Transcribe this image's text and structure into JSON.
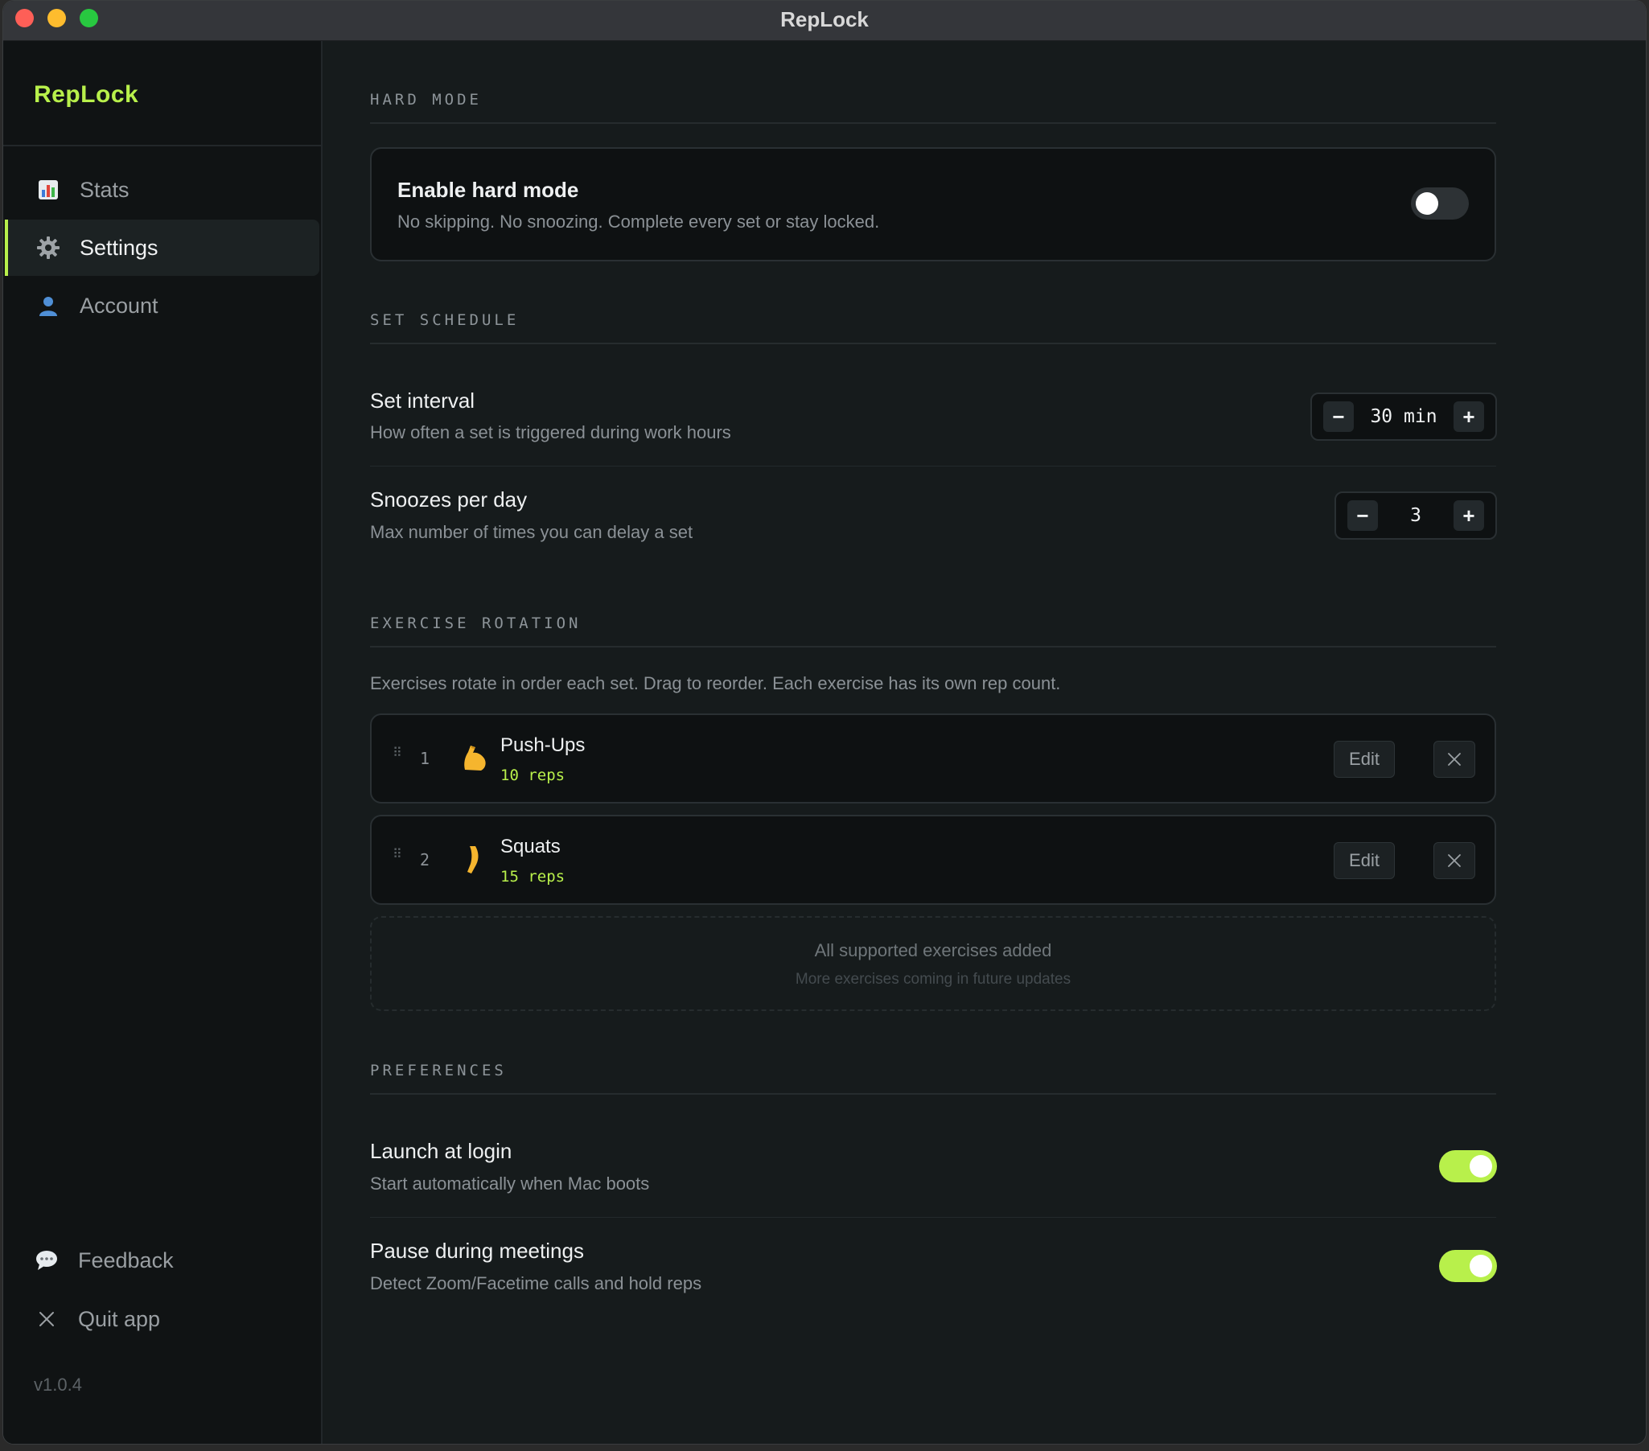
{
  "window": {
    "title": "RepLock"
  },
  "sidebar": {
    "brand": "RepLock",
    "nav": [
      {
        "label": "Stats",
        "icon": "bar-chart-icon"
      },
      {
        "label": "Settings",
        "icon": "gear-icon",
        "active": true
      },
      {
        "label": "Account",
        "icon": "user-icon"
      }
    ],
    "footer": [
      {
        "label": "Feedback",
        "icon": "speech-bubble-icon"
      },
      {
        "label": "Quit app",
        "icon": "close-icon"
      }
    ],
    "version": "v1.0.4"
  },
  "hard_mode": {
    "section_title": "HARD MODE",
    "label": "Enable hard mode",
    "description": "No skipping. No snoozing. Complete every set or stay locked.",
    "enabled": false
  },
  "schedule": {
    "section_title": "SET SCHEDULE",
    "interval": {
      "label": "Set interval",
      "description": "How often a set is triggered during work hours",
      "value": "30 min",
      "minus": "−",
      "plus": "+"
    },
    "snoozes": {
      "label": "Snoozes per day",
      "description": "Max number of times you can delay a set",
      "value": "3",
      "minus": "−",
      "plus": "+"
    }
  },
  "rotation": {
    "section_title": "EXERCISE ROTATION",
    "description": "Exercises rotate in order each set. Drag to reorder. Each exercise has its own rep count.",
    "exercises": [
      {
        "index": "1",
        "name": "Push-Ups",
        "reps": "10 reps",
        "icon": "flexed-biceps-icon",
        "edit": "Edit"
      },
      {
        "index": "2",
        "name": "Squats",
        "reps": "15 reps",
        "icon": "leg-icon",
        "edit": "Edit"
      }
    ],
    "empty_title": "All supported exercises added",
    "empty_sub": "More exercises coming in future updates"
  },
  "preferences": {
    "section_title": "PREFERENCES",
    "launch": {
      "label": "Launch at login",
      "description": "Start automatically when Mac boots",
      "enabled": true
    },
    "meetings": {
      "label": "Pause during meetings",
      "description": "Detect Zoom/Facetime calls and hold reps",
      "enabled": true
    }
  },
  "colors": {
    "accent": "#b8f04b",
    "background": "#161b1c",
    "sidebar": "#101314"
  }
}
